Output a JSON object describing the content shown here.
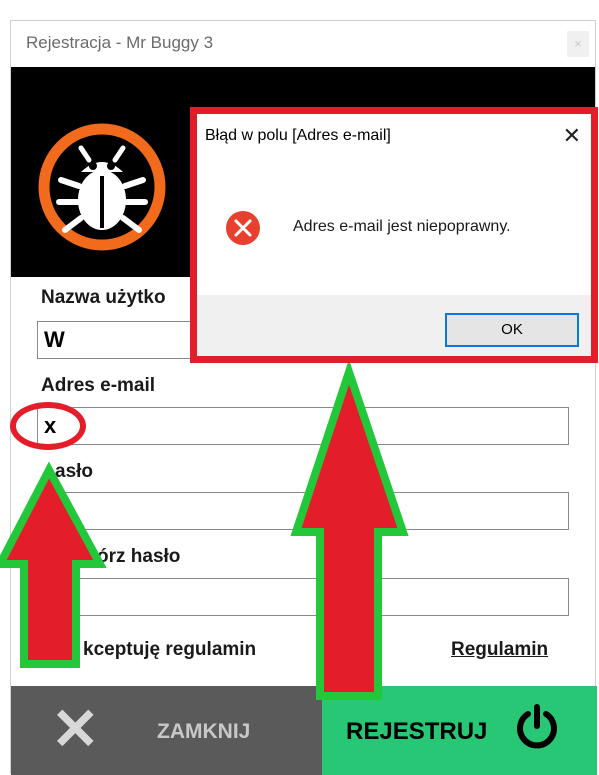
{
  "window": {
    "title": "Rejestracja - Mr Buggy 3",
    "close_glyph": "×"
  },
  "form": {
    "username_label": "Nazwa użytko",
    "username_value": "W",
    "email_label": "Adres e-mail",
    "email_value": "x",
    "password_label": "asło",
    "confirm_label": "órz hasło",
    "accept_label": "kceptuję regulamin",
    "terms_link": "Regulamin"
  },
  "buttons": {
    "close_label": "ZAMKNIJ",
    "close_icon": "x-icon",
    "register_label": "REJESTRUJ",
    "register_icon": "power-icon"
  },
  "dialog": {
    "title": "Błąd w polu [Adres e-mail]",
    "close_glyph": "✕",
    "message": "Adres e-mail jest niepoprawny.",
    "ok_label": "OK",
    "icon": "error-icon"
  },
  "colors": {
    "annotation_red": "#e41d2b",
    "annotation_green": "#22c83a",
    "register_green": "#27c776",
    "logo_orange": "#f26a1b"
  }
}
